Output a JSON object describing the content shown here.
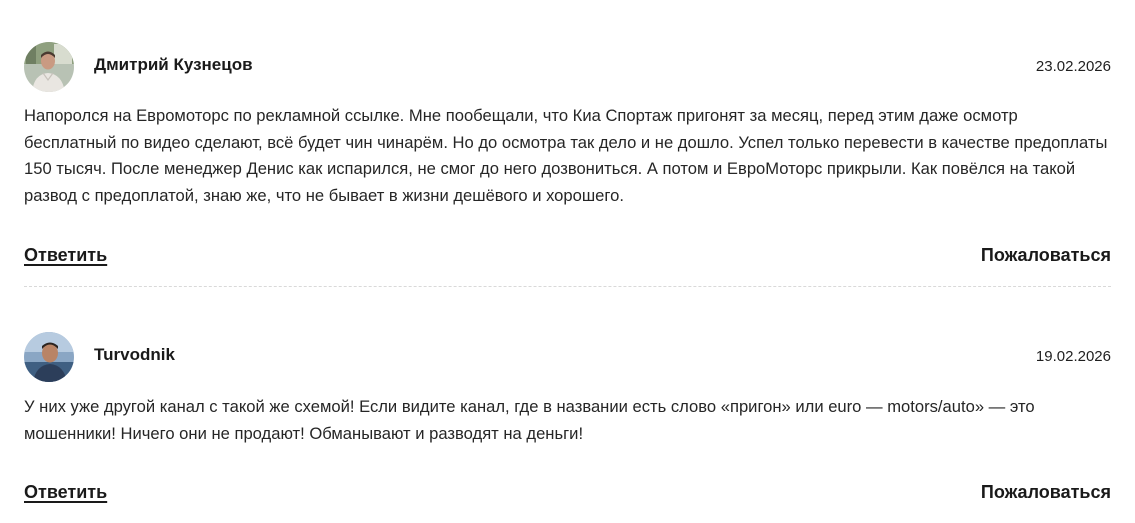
{
  "comments": [
    {
      "author": "Дмитрий Кузнецов",
      "date": "23.02.2026",
      "text": "Напоролся на Евромоторс по рекламной ссылке. Мне пообещали, что Киа Спортаж пригонят за месяц, перед этим даже осмотр бесплатный по видео сделают, всё будет чин чинарём. Но до осмотра так дело и не дошло. Успел только перевести в качестве предоплаты 150 тысяч. После менеджер Денис как испарился, не смог до него дозвониться. А потом и ЕвроМоторс прикрыли. Как повёлся на такой развод с предоплатой, знаю же, что не бывает в жизни дешёвого и хорошего.",
      "reply_label": "Ответить",
      "report_label": "Пожаловаться",
      "avatar_icon": "user-photo-avatar"
    },
    {
      "author": "Turvodnik",
      "date": "19.02.2026",
      "text": "У них уже другой канал с такой же схемой! Если видите канал, где в названии есть слово «пригон» или euro — motors/auto» — это мошенники! Ничего они не продают! Обманывают и разводят на деньги!",
      "reply_label": "Ответить",
      "report_label": "Пожаловаться",
      "avatar_icon": "user-photo-avatar"
    }
  ],
  "colors": {
    "text": "#262626",
    "divider": "#d9d9d9"
  }
}
